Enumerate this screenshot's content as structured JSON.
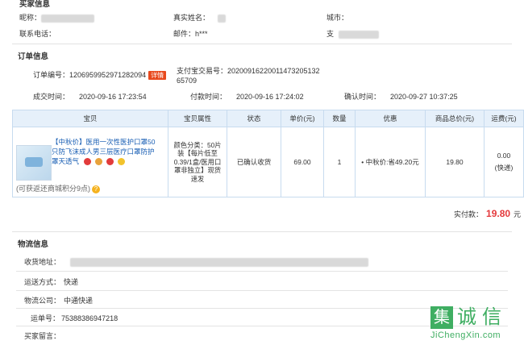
{
  "buyer": {
    "title": "买家信息",
    "nickname_label": "昵称：",
    "realname_label": "真实姓名：",
    "city_label": "城市：",
    "phone_label": "联系电话：",
    "email_label": "邮件：",
    "email_value": "h***",
    "alipay_label": "支"
  },
  "order": {
    "title": "订单信息",
    "order_no_label": "订单编号：",
    "order_no": "1206959952971282094",
    "order_badge": "详情",
    "alipay_no_label": "支付宝交易号：",
    "alipay_no_line1": "2020091622001147320513​2",
    "alipay_no_line2": "65709",
    "deal_time_label": "成交时间：",
    "deal_time": "2020-09-16 17:23:54",
    "pay_time_label": "付款时间：",
    "pay_time": "2020-09-16 17:24:02",
    "confirm_time_label": "确认时间：",
    "confirm_time": "2020-09-27 10:37:25"
  },
  "goods_table": {
    "headers": [
      "宝贝",
      "宝贝属性",
      "状态",
      "单价(元)",
      "数量",
      "优惠",
      "商品总价(元)",
      "运费(元)"
    ],
    "item": {
      "title": "【中秋价】医用一次性医护口罩50只防飞沫成人男三层医疗口罩防护罩天透气",
      "attr": "颜色分类：50片装【每片低至0.39/1盒/医用口罩非独立】现货速发",
      "status": "已确认收货",
      "price": "69.00",
      "qty": "1",
      "discount": "中秋价:省49.20元",
      "total": "19.80",
      "freight": "0.00",
      "freight_type": "(快递)"
    }
  },
  "points_note": "(可获返还商城积分9点)",
  "payment": {
    "label": "实付款：",
    "amount": "19.80",
    "unit": "元"
  },
  "logistics": {
    "title": "物流信息",
    "address_label": "收货地址：",
    "method_label": "运送方式：",
    "method": "快递",
    "company_label": "物流公司：",
    "company": "中通快递",
    "tracking_label": "运单号：",
    "tracking": "75388386947218",
    "message_label": "买家留言："
  },
  "watermark": {
    "char1": "集",
    "char2": "诚",
    "char3": "信",
    "domain": "JiChengXin.com"
  }
}
